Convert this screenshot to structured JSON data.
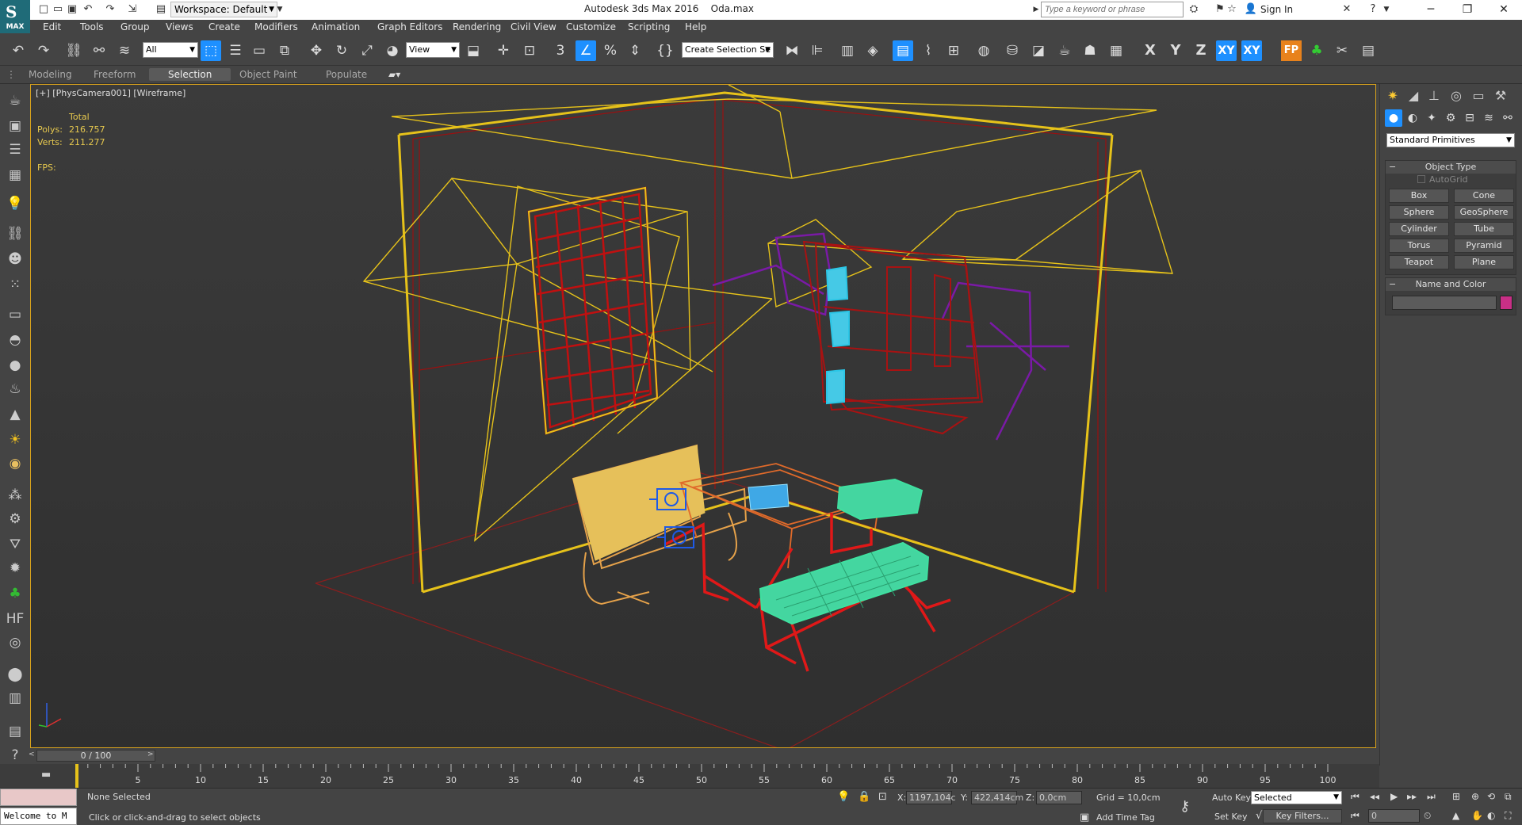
{
  "titlebar": {
    "app_name": "Autodesk 3ds Max 2016",
    "file_name": "Oda.max",
    "workspace": "Workspace: Default",
    "search_placeholder": "Type a keyword or phrase",
    "sign_in": "Sign In",
    "logo_text": "MAX"
  },
  "menu": [
    "Edit",
    "Tools",
    "Group",
    "Views",
    "Create",
    "Modifiers",
    "Animation",
    "Graph Editors",
    "Rendering",
    "Civil View",
    "Customize",
    "Scripting",
    "Help"
  ],
  "toolbar": {
    "selection_filter": "All",
    "ref_coord": "View",
    "named_selection": "Create Selection Se",
    "axes": [
      "X",
      "Y",
      "Z",
      "XY",
      "XY"
    ]
  },
  "ribbon": {
    "tabs": [
      "Modeling",
      "Freeform",
      "Selection",
      "Object Paint",
      "Populate"
    ],
    "active": "Selection"
  },
  "viewport": {
    "label": "[+] [PhysCamera001] [Wireframe]",
    "stats": {
      "total_label": "Total",
      "polys_label": "Polys:",
      "polys": "216.757",
      "verts_label": "Verts:",
      "verts": "211.277",
      "fps_label": "FPS:"
    }
  },
  "command_panel": {
    "category": "Standard Primitives",
    "object_type_title": "Object Type",
    "autogrid": "AutoGrid",
    "primitives": [
      "Box",
      "Cone",
      "Sphere",
      "GeoSphere",
      "Cylinder",
      "Tube",
      "Torus",
      "Pyramid",
      "Teapot",
      "Plane"
    ],
    "name_color_title": "Name and Color",
    "color": "#c82f86"
  },
  "timeslider": {
    "position": "0 / 100",
    "prev": "<",
    "next": ">"
  },
  "trackbar": {
    "ticks": [
      0,
      5,
      10,
      15,
      20,
      25,
      30,
      35,
      40,
      45,
      50,
      55,
      60,
      65,
      70,
      75,
      80,
      85,
      90,
      95,
      100
    ],
    "labels": [
      "5",
      "10",
      "15",
      "20",
      "25",
      "30",
      "35",
      "40",
      "45",
      "50",
      "55",
      "60",
      "65",
      "70",
      "75",
      "80",
      "85",
      "90",
      "95",
      "100"
    ]
  },
  "status": {
    "maxscript": "Welcome to M",
    "selection": "None Selected",
    "prompt": "Click or click-and-drag to select objects",
    "x_label": "X:",
    "x_value": "1197,104c",
    "y_label": "Y:",
    "y_value": "422,414cm",
    "z_label": "Z:",
    "z_value": "0,0cm",
    "grid": "Grid = 10,0cm",
    "add_time_tag": "Add Time Tag",
    "auto_key": "Auto Key",
    "set_key": "Set Key",
    "key_mode": "Selected",
    "key_filters": "Key Filters...",
    "frame": "0"
  }
}
